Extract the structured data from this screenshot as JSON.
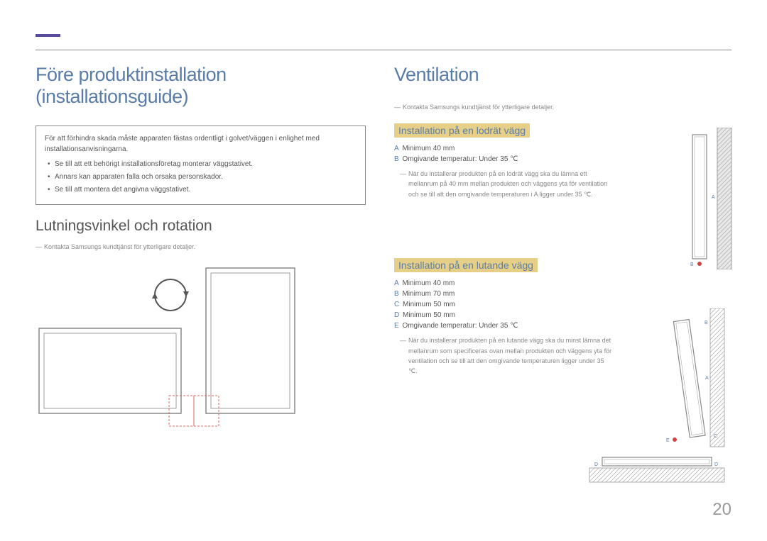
{
  "left": {
    "h1": "Före produktinstallation (installationsguide)",
    "boxText": "För att förhindra skada måste apparaten fästas ordentligt i golvet/väggen i enlighet med installationsanvisningarna.",
    "boxList": [
      "Se till att ett behörigt installationsföretag monterar väggstativet.",
      "Annars kan apparaten falla och orsaka personskador.",
      "Se till att montera det angivna väggstativet."
    ],
    "h2": "Lutningsvinkel och rotation",
    "footnote": "Kontakta Samsungs kundtjänst för ytterligare detaljer."
  },
  "right": {
    "h1": "Ventilation",
    "footnote": "Kontakta Samsungs kundtjänst för ytterligare detaljer.",
    "section1": {
      "h3": "Installation på en lodrät vägg",
      "specs": [
        {
          "label": "A",
          "text": "Minimum 40 mm"
        },
        {
          "label": "B",
          "text": "Omgivande temperatur: Under 35 ℃"
        }
      ],
      "note": "När du installerar produkten på en lodrät vägg ska du lämna ett mellanrum på 40 mm mellan produkten och väggens yta för ventilation och se till att den omgivande temperaturen i A ligger under 35 ℃."
    },
    "section2": {
      "h3": "Installation på en lutande vägg",
      "specs": [
        {
          "label": "A",
          "text": "Minimum 40 mm"
        },
        {
          "label": "B",
          "text": "Minimum 70 mm"
        },
        {
          "label": "C",
          "text": "Minimum 50 mm"
        },
        {
          "label": "D",
          "text": "Minimum 50 mm"
        },
        {
          "label": "E",
          "text": "Omgivande temperatur: Under 35 ℃"
        }
      ],
      "note": "När du installerar produkten på en lutande vägg ska du minst lämna det mellanrum som specificeras ovan mellan produkten och väggens yta för ventilation och se till att den omgivande temperaturen ligger under 35 ℃."
    }
  },
  "pageNumber": "20",
  "labels": {
    "A": "A",
    "B": "B",
    "C": "C",
    "D": "D",
    "E": "E"
  }
}
